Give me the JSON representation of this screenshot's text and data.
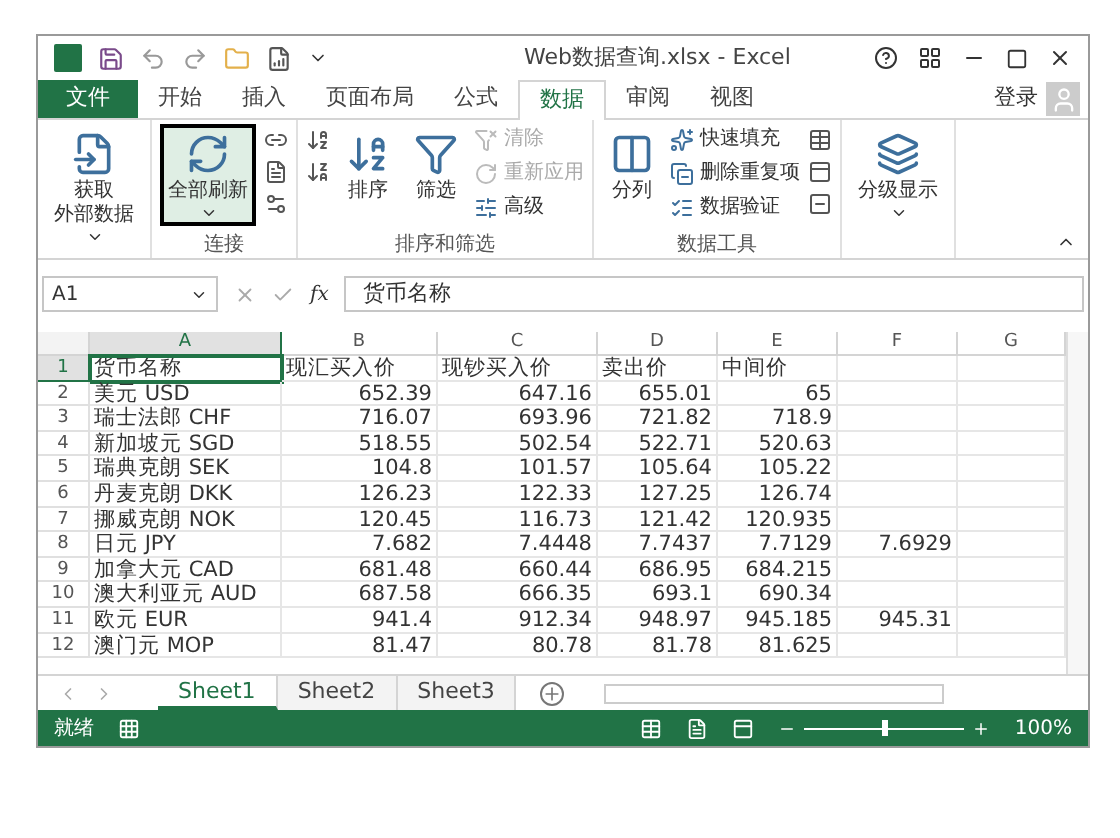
{
  "window": {
    "title": "Web数据查询.xlsx - Excel"
  },
  "ribbon_tabs": [
    {
      "label": "文件",
      "kind": "file",
      "selected": false
    },
    {
      "label": "开始",
      "kind": "tab",
      "selected": false
    },
    {
      "label": "插入",
      "kind": "tab",
      "selected": false
    },
    {
      "label": "页面布局",
      "kind": "tab",
      "selected": false
    },
    {
      "label": "公式",
      "kind": "tab",
      "selected": false
    },
    {
      "label": "数据",
      "kind": "tab",
      "selected": true
    },
    {
      "label": "审阅",
      "kind": "tab",
      "selected": false
    },
    {
      "label": "视图",
      "kind": "tab",
      "selected": false
    }
  ],
  "account": {
    "label": "登录"
  },
  "ribbon_groups": [
    {
      "items": [
        {
          "kind": "large",
          "lines": [
            "获取",
            "外部数据"
          ],
          "dropdown": true,
          "selected": false
        }
      ]
    },
    {
      "label": "连接",
      "items": [
        {
          "kind": "large",
          "lines": [
            "全部刷新"
          ],
          "dropdown": true,
          "selected": true
        },
        {
          "kind": "icons"
        }
      ]
    },
    {
      "label": "排序和筛选",
      "items": [
        {
          "kind": "icons"
        },
        {
          "kind": "large",
          "lines": [
            "排序"
          ],
          "dropdown": false,
          "selected": false
        },
        {
          "kind": "large",
          "lines": [
            "筛选"
          ],
          "dropdown": false,
          "selected": false
        },
        {
          "kind": "small",
          "entries": [
            {
              "label": "清除",
              "disabled": true
            },
            {
              "label": "重新应用",
              "disabled": true
            },
            {
              "label": "高级",
              "disabled": false
            }
          ]
        }
      ]
    },
    {
      "label": "数据工具",
      "items": [
        {
          "kind": "large",
          "lines": [
            "分列"
          ],
          "dropdown": false,
          "selected": false
        },
        {
          "kind": "small",
          "entries": [
            {
              "label": "快速填充",
              "disabled": false
            },
            {
              "label": "删除重复项",
              "disabled": false
            },
            {
              "label": "数据验证",
              "disabled": false
            }
          ]
        },
        {
          "kind": "icons"
        }
      ]
    },
    {
      "items": [
        {
          "kind": "large",
          "lines": [
            "分级显示"
          ],
          "dropdown": true,
          "selected": false
        }
      ]
    }
  ],
  "formula_bar": {
    "name_box": "A1",
    "function_button": "fx",
    "formula": "货币名称"
  },
  "columns": [
    {
      "label": "A",
      "selected": true
    },
    {
      "label": "B",
      "selected": false
    },
    {
      "label": "C",
      "selected": false
    },
    {
      "label": "D",
      "selected": false
    },
    {
      "label": "E",
      "selected": false
    },
    {
      "label": "F",
      "selected": false
    },
    {
      "label": "G",
      "selected": false
    }
  ],
  "rows": [
    {
      "number": "1",
      "selected": true,
      "cells": [
        "货币名称",
        "现汇买入价",
        "现钞买入价",
        "卖出价",
        "中间价"
      ]
    },
    {
      "number": "2",
      "selected": false,
      "cells": [
        "美元 USD",
        "652.39",
        "647.16",
        "655.01",
        "65"
      ]
    },
    {
      "number": "3",
      "selected": false,
      "cells": [
        "瑞士法郎 CHF",
        "716.07",
        "693.96",
        "721.82",
        "718.9"
      ]
    },
    {
      "number": "4",
      "selected": false,
      "cells": [
        "新加坡元 SGD",
        "518.55",
        "502.54",
        "522.71",
        "520.63"
      ]
    },
    {
      "number": "5",
      "selected": false,
      "cells": [
        "瑞典克朗 SEK",
        "104.8",
        "101.57",
        "105.64",
        "105.22"
      ]
    },
    {
      "number": "6",
      "selected": false,
      "cells": [
        "丹麦克朗 DKK",
        "126.23",
        "122.33",
        "127.25",
        "126.74"
      ]
    },
    {
      "number": "7",
      "selected": false,
      "cells": [
        "挪威克朗 NOK",
        "120.45",
        "116.73",
        "121.42",
        "120.935"
      ]
    },
    {
      "number": "8",
      "selected": false,
      "cells": [
        "日元 JPY",
        "7.682",
        "7.4448",
        "7.7437",
        "7.7129",
        "7.6929"
      ]
    },
    {
      "number": "9",
      "selected": false,
      "cells": [
        "加拿大元 CAD",
        "681.48",
        "660.44",
        "686.95",
        "684.215"
      ]
    },
    {
      "number": "10",
      "selected": false,
      "cells": [
        "澳大利亚元 AUD",
        "687.58",
        "666.35",
        "693.1",
        "690.34"
      ]
    },
    {
      "number": "11",
      "selected": false,
      "cells": [
        "欧元 EUR",
        "941.4",
        "912.34",
        "948.97",
        "945.185",
        "945.31"
      ]
    },
    {
      "number": "12",
      "selected": false,
      "cells": [
        "澳门元 MOP",
        "81.47",
        "80.78",
        "81.78",
        "81.625"
      ]
    }
  ],
  "sheet_tabs": [
    {
      "label": "Sheet1",
      "selected": true
    },
    {
      "label": "Sheet2",
      "selected": false
    },
    {
      "label": "Sheet3",
      "selected": false
    }
  ],
  "status_bar": {
    "status": "就绪",
    "zoom": "100%",
    "zoom_level": {
      "level": 0.5
    }
  }
}
